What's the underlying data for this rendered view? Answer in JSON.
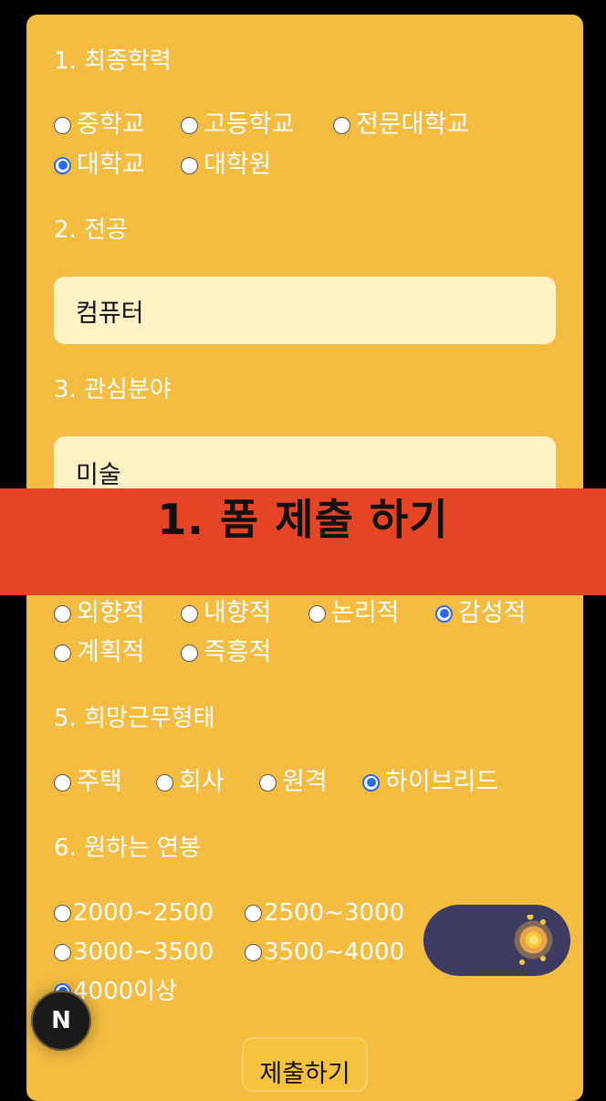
{
  "q1": {
    "label": "1. 최종학력",
    "options": [
      {
        "label": "중학교",
        "checked": false
      },
      {
        "label": "고등학교",
        "checked": false
      },
      {
        "label": "전문대학교",
        "checked": false
      },
      {
        "label": "대학교",
        "checked": true
      },
      {
        "label": "대학원",
        "checked": false
      }
    ]
  },
  "q2": {
    "label": "2. 전공",
    "value": "컴퓨터"
  },
  "q3": {
    "label": "3. 관심분야",
    "value": "미술"
  },
  "banner": {
    "text": "1. 폼 제출 하기"
  },
  "q4": {
    "options": [
      {
        "label": "외향적",
        "checked": false
      },
      {
        "label": "내향적",
        "checked": false
      },
      {
        "label": "논리적",
        "checked": false
      },
      {
        "label": "감성적",
        "checked": true
      },
      {
        "label": "계획적",
        "checked": false
      },
      {
        "label": "즉흥적",
        "checked": false
      }
    ]
  },
  "q5": {
    "label": "5. 희망근무형태",
    "options": [
      {
        "label": "주택",
        "checked": false
      },
      {
        "label": "회사",
        "checked": false
      },
      {
        "label": "원격",
        "checked": false
      },
      {
        "label": "하이브리드",
        "checked": true
      }
    ]
  },
  "q6": {
    "label": "6. 원하는 연봉",
    "options": [
      {
        "label": "2000~2500",
        "checked": false
      },
      {
        "label": "2500~3000",
        "checked": false
      },
      {
        "label": "3000~3500",
        "checked": false
      },
      {
        "label": "3500~4000",
        "checked": false
      },
      {
        "label": "4000이상",
        "checked": true
      }
    ]
  },
  "submit": {
    "label": "제출하기"
  },
  "badge": {
    "letter": "N"
  },
  "colors": {
    "card": "#F5BC42",
    "banner": "#E54425",
    "input_bg": "#FEF2C6",
    "radio_checked": "#2C6BEF",
    "toggle": "#3E3B63",
    "sun": "#F9C73D"
  },
  "toggle": {
    "icon": "sun-icon",
    "state": "light"
  }
}
